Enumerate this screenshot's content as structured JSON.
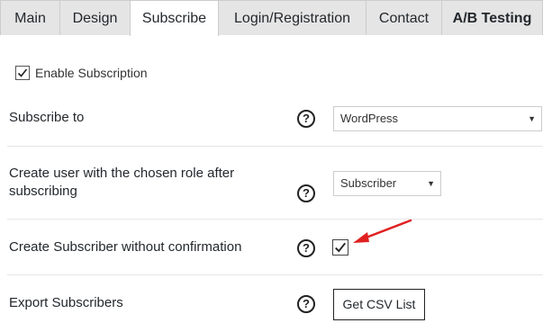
{
  "tabs": [
    {
      "label": "Main"
    },
    {
      "label": "Design"
    },
    {
      "label": "Subscribe"
    },
    {
      "label": "Login/Registration"
    },
    {
      "label": "Contact"
    },
    {
      "label": "A/B Testing"
    }
  ],
  "active_tab": "Subscribe",
  "enable_subscription": {
    "label": "Enable Subscription",
    "checked": true
  },
  "rows": {
    "subscribe_to": {
      "label": "Subscribe to",
      "value": "WordPress"
    },
    "role": {
      "label_line1": "Create user with the chosen role after",
      "label_line2": "subscribing",
      "value": "Subscriber"
    },
    "no_confirmation": {
      "label": "Create Subscriber without confirmation",
      "checked": true
    },
    "export": {
      "label": "Export Subscribers",
      "button": "Get CSV List"
    }
  },
  "help_glyph": "?",
  "colors": {
    "annotation_arrow": "#e02020",
    "tab_inactive": "#e5e5e5"
  }
}
